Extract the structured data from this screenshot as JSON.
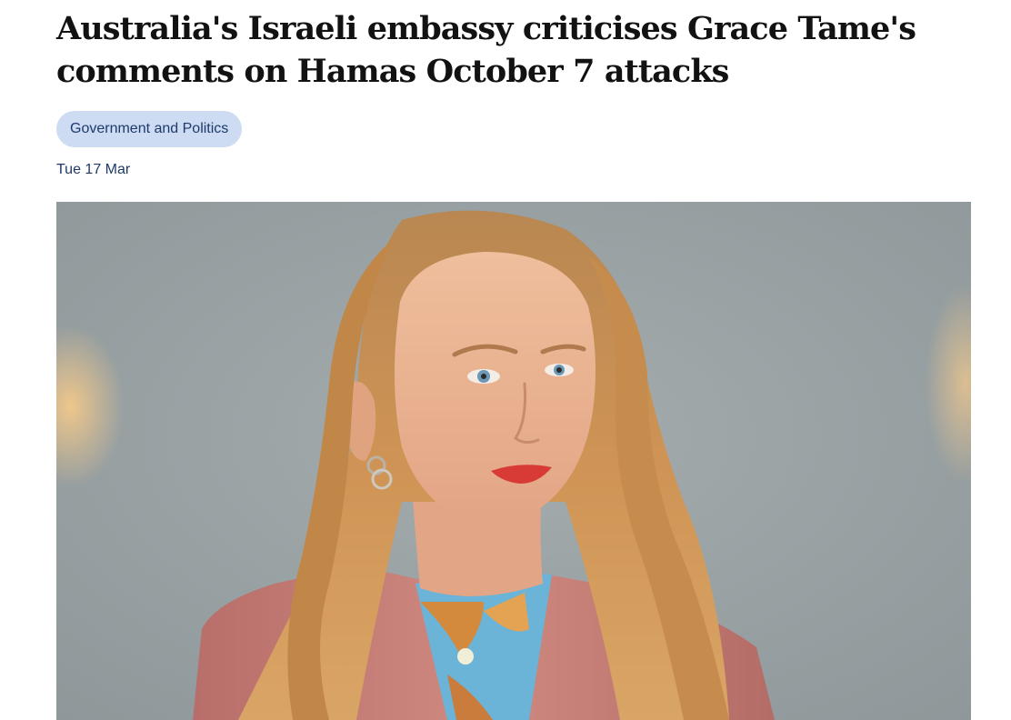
{
  "article": {
    "headline": "Australia's Israeli embassy criticises Grace Tame's comments on Hamas October 7 attacks",
    "tag_label": "Government and Politics",
    "date": "Tue 17 Mar",
    "hero_image": {
      "subject": "portrait photograph",
      "colors": {
        "background": "#9aa3a6",
        "hair": "#c98c4e",
        "skin": "#eab391",
        "jacket": "#c07a72",
        "lips": "#d83a35",
        "eyes": "#6a98b6"
      }
    }
  }
}
